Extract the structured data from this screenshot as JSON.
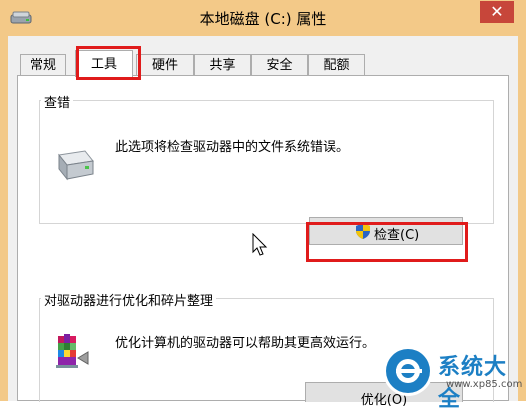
{
  "window": {
    "title": "本地磁盘 (C:) 属性",
    "close_glyph": "✕"
  },
  "tabs": [
    {
      "label": "常规"
    },
    {
      "label": "工具"
    },
    {
      "label": "硬件"
    },
    {
      "label": "共享"
    },
    {
      "label": "安全"
    },
    {
      "label": "配额"
    }
  ],
  "active_tab": "工具",
  "error_check": {
    "group_title": "查错",
    "description": "此选项将检查驱动器中的文件系统错误。",
    "button_label": "检查(C)",
    "icon": "hard-drive-icon",
    "button_icon": "uac-shield-icon"
  },
  "optimize": {
    "group_title": "对驱动器进行优化和碎片整理",
    "description": "优化计算机的驱动器可以帮助其更高效运行。",
    "button_label": "优化(O)",
    "icon": "defragment-icon"
  },
  "watermark": {
    "brand": "系统大全",
    "url": "www.xp85.com"
  },
  "colors": {
    "title_bar": "#f3c988",
    "close_button": "#c7463a",
    "highlight": "#e01b1b",
    "watermark_blue": "#1c7fc4"
  }
}
